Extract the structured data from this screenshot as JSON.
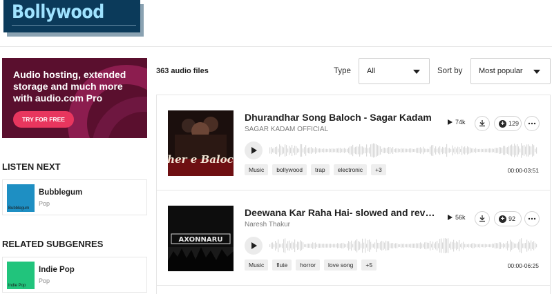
{
  "header": {
    "title": "Bollywood"
  },
  "promo": {
    "text": "Audio hosting, extended storage and much more with audio.com Pro",
    "button": "TRY FOR FREE"
  },
  "listen_next": {
    "title": "LISTEN NEXT",
    "item": {
      "name": "Bubblegum",
      "genre": "Pop",
      "thumb_label": "Bubblegum",
      "thumb_color": "#1e8fc3"
    }
  },
  "related": {
    "title": "RELATED SUBGENRES",
    "item": {
      "name": "Indie Pop",
      "genre": "Pop",
      "thumb_label": "Indie Pop",
      "thumb_color": "#21c47c"
    }
  },
  "filters": {
    "count": "363 audio files",
    "type_label": "Type",
    "type_value": "All",
    "sort_label": "Sort by",
    "sort_value": "Most popular"
  },
  "tracks": [
    {
      "title": "Dhurandhar Song Baloch - Sagar Kadam",
      "artist": "SAGAR KADAM OFFICIAL",
      "plays": "74k",
      "likes": "129",
      "tags": [
        "Music",
        "bollywood",
        "trap",
        "electronic",
        "+3"
      ],
      "duration": "00:00-03:51",
      "art_text": "Sher e Baloch"
    },
    {
      "title": "Deewana Kar Raha Hai- slowed and reverb",
      "artist": "Naresh Thakur",
      "plays": "56k",
      "likes": "92",
      "tags": [
        "Music",
        "flute",
        "horror",
        "love song",
        "+5"
      ],
      "duration": "00:00-06:25",
      "art_text": "AXONNARU"
    }
  ]
}
